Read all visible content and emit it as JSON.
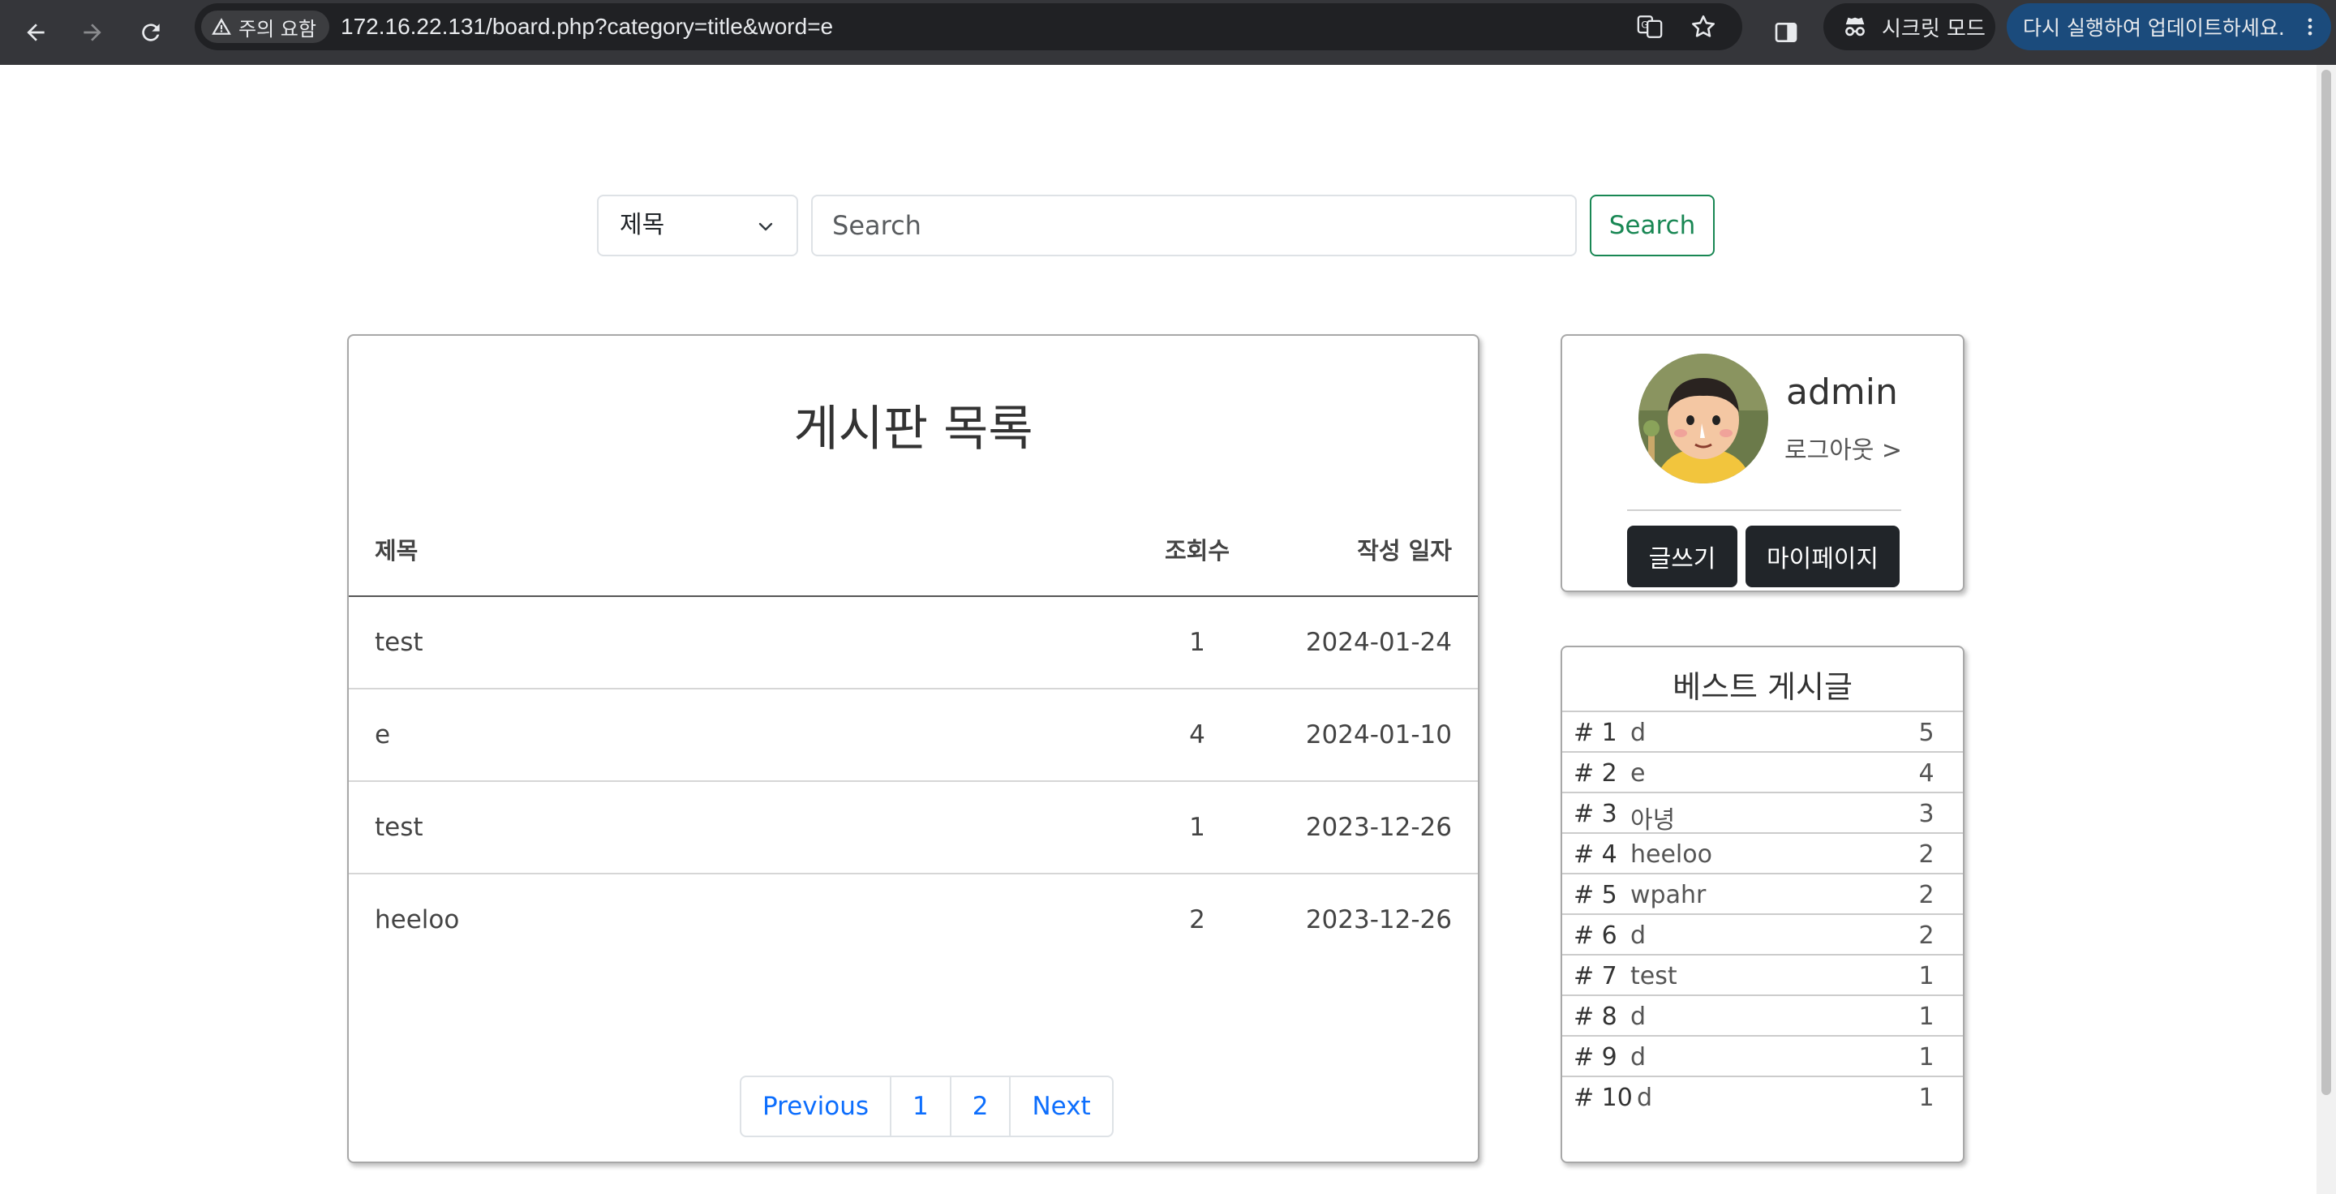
{
  "browser": {
    "security_label": "주의 요함",
    "url": "172.16.22.131/board.php?category=title&word=e",
    "incognito_label": "시크릿 모드",
    "update_label": "다시 실행하여 업데이트하세요."
  },
  "search": {
    "category_value": "제목",
    "placeholder": "Search",
    "button_label": "Search"
  },
  "board": {
    "title": "게시판 목록",
    "columns": {
      "title": "제목",
      "views": "조회수",
      "date": "작성 일자"
    },
    "rows": [
      {
        "title": "test",
        "views": "1",
        "date": "2024-01-24"
      },
      {
        "title": "e",
        "views": "4",
        "date": "2024-01-10"
      },
      {
        "title": "test",
        "views": "1",
        "date": "2023-12-26"
      },
      {
        "title": "heeloo",
        "views": "2",
        "date": "2023-12-26"
      }
    ],
    "pagination": {
      "previous": "Previous",
      "pages": [
        "1",
        "2"
      ],
      "next": "Next"
    }
  },
  "profile": {
    "username": "admin",
    "logout": "로그아웃 >",
    "write_button": "글쓰기",
    "mypage_button": "마이페이지"
  },
  "best_posts": {
    "title": "베스트 게시글",
    "items": [
      {
        "rank": "# 1",
        "title": "d",
        "views": "5"
      },
      {
        "rank": "# 2",
        "title": "e",
        "views": "4"
      },
      {
        "rank": "# 3",
        "title": "아녕",
        "views": "3"
      },
      {
        "rank": "# 4",
        "title": "heeloo",
        "views": "2"
      },
      {
        "rank": "# 5",
        "title": "wpahr",
        "views": "2"
      },
      {
        "rank": "# 6",
        "title": "d",
        "views": "2"
      },
      {
        "rank": "# 7",
        "title": "test",
        "views": "1"
      },
      {
        "rank": "# 8",
        "title": "d",
        "views": "1"
      },
      {
        "rank": "# 9",
        "title": "d",
        "views": "1"
      },
      {
        "rank": "# 10",
        "title": "d",
        "views": "1"
      }
    ]
  },
  "colors": {
    "success": "#198754",
    "link": "#0d6efd",
    "dark_button": "#212529",
    "chrome_bg": "#35363a"
  },
  "icons": [
    "back-arrow-icon",
    "forward-arrow-icon",
    "reload-icon",
    "warning-icon",
    "translate-icon",
    "star-icon",
    "side-panel-icon",
    "incognito-icon",
    "more-vert-icon",
    "chevron-down-icon"
  ]
}
